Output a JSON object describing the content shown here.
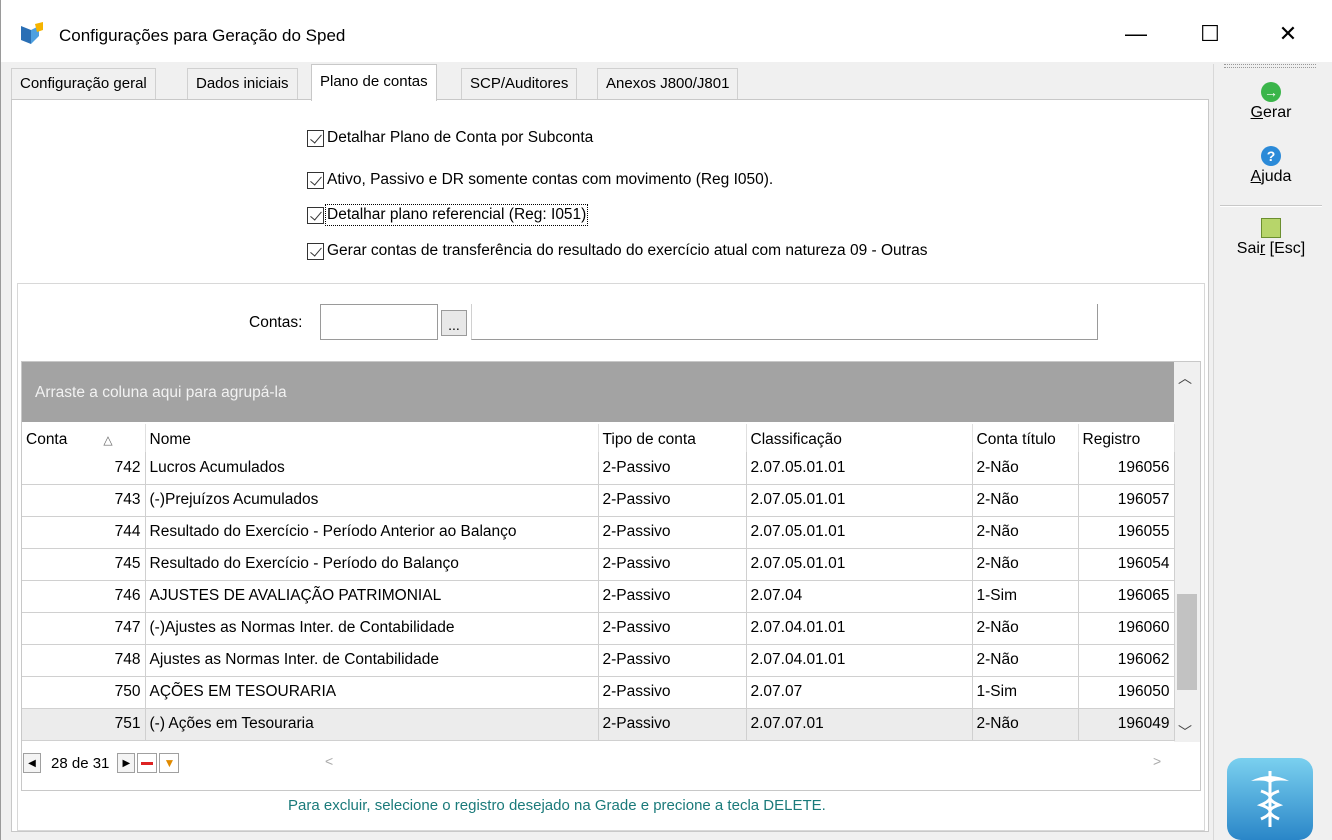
{
  "window": {
    "title": "Configurações para Geração do Sped",
    "minimize_symbol": "—",
    "maximize_symbol": "☐",
    "close_symbol": "✕"
  },
  "tabs": [
    {
      "label": "Configuração geral",
      "active": false
    },
    {
      "label": "Dados iniciais",
      "active": false
    },
    {
      "label": "Plano de contas",
      "active": true
    },
    {
      "label": "SCP/Auditores",
      "active": false
    },
    {
      "label": "Anexos J800/J801",
      "active": false
    }
  ],
  "options": [
    {
      "label": "Detalhar Plano de Conta por Subconta",
      "checked": true
    },
    {
      "label": "Ativo, Passivo e DR somente contas com movimento (Reg I050).",
      "checked": true
    },
    {
      "label": "Detalhar plano referencial (Reg: I051)",
      "checked": true
    },
    {
      "label": "Gerar contas de transferência do resultado do exercício atual com natureza 09 - Outras",
      "checked": true
    }
  ],
  "contas": {
    "label": "Contas:",
    "value": "",
    "lookup_label": "..."
  },
  "grid": {
    "group_hint": "Arraste a coluna aqui para agrupá-la",
    "columns": [
      "Conta",
      "Nome",
      "Tipo de conta",
      "Classificação",
      "Conta título",
      "Registro"
    ],
    "rows": [
      [
        "742",
        "Lucros Acumulados",
        "2-Passivo",
        "2.07.05.01.01",
        "2-Não",
        "196056"
      ],
      [
        "743",
        "(-)Prejuízos Acumulados",
        "2-Passivo",
        "2.07.05.01.01",
        "2-Não",
        "196057"
      ],
      [
        "744",
        "Resultado do Exercício - Período Anterior ao Balanço",
        "2-Passivo",
        "2.07.05.01.01",
        "2-Não",
        "196055"
      ],
      [
        "745",
        "Resultado do Exercício - Período do Balanço",
        "2-Passivo",
        "2.07.05.01.01",
        "2-Não",
        "196054"
      ],
      [
        "746",
        "AJUSTES DE AVALIAÇÃO PATRIMONIAL",
        "2-Passivo",
        "2.07.04",
        "1-Sim",
        "196065"
      ],
      [
        "747",
        "(-)Ajustes as Normas Inter. de Contabilidade",
        "2-Passivo",
        "2.07.04.01.01",
        "2-Não",
        "196060"
      ],
      [
        "748",
        "Ajustes as Normas Inter. de Contabilidade",
        "2-Passivo",
        "2.07.04.01.01",
        "2-Não",
        "196062"
      ],
      [
        "750",
        "AÇÕES EM TESOURARIA",
        "2-Passivo",
        "2.07.07",
        "1-Sim",
        "196050"
      ],
      [
        "751",
        "(-) Ações em Tesouraria",
        "2-Passivo",
        "2.07.07.01",
        "2-Não",
        "196049"
      ]
    ],
    "selected_row": 8,
    "navigator": {
      "position": "28 de 31"
    }
  },
  "footer_message": "Para excluir, selecione o registro desejado na Grade e precione a tecla DELETE.",
  "toolbar": {
    "gerar_prefix": "G",
    "gerar_rest": "erar",
    "ajuda_prefix": "A",
    "ajuda_rest": "juda",
    "sair_a": "Sai",
    "sair_u": "r",
    "sair_b": " [Esc]"
  },
  "colors": {
    "group_bar": "#a3a3a3",
    "footer_text": "#1a7a7a",
    "accent_green": "#3ab54a",
    "accent_blue": "#2b8ad8"
  }
}
